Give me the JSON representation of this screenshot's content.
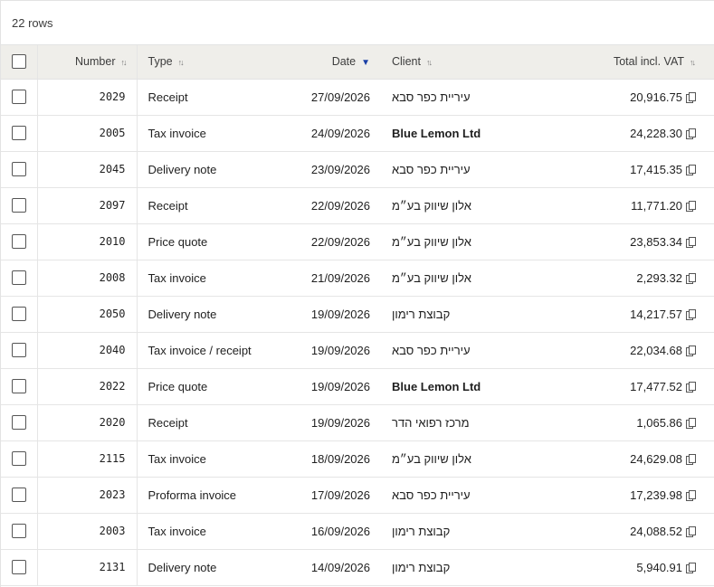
{
  "row_count_label": "22 rows",
  "columns": {
    "number": "Number",
    "type": "Type",
    "date": "Date",
    "client": "Client",
    "total": "Total incl. VAT"
  },
  "sort": {
    "column": "date",
    "direction": "descending"
  },
  "rows": [
    {
      "number": "2029",
      "type": "Receipt",
      "date": "27/09/2026",
      "client": "עיריית כפר סבא",
      "total": "20,916.75"
    },
    {
      "number": "2005",
      "type": "Tax invoice",
      "date": "24/09/2026",
      "client": "Blue Lemon Ltd",
      "total": "24,228.30"
    },
    {
      "number": "2045",
      "type": "Delivery note",
      "date": "23/09/2026",
      "client": "עיריית כפר סבא",
      "total": "17,415.35"
    },
    {
      "number": "2097",
      "type": "Receipt",
      "date": "22/09/2026",
      "client": "אלון שיווק בע״מ",
      "total": "11,771.20"
    },
    {
      "number": "2010",
      "type": "Price quote",
      "date": "22/09/2026",
      "client": "אלון שיווק בע״מ",
      "total": "23,853.34"
    },
    {
      "number": "2008",
      "type": "Tax invoice",
      "date": "21/09/2026",
      "client": "אלון שיווק בע״מ",
      "total": "2,293.32"
    },
    {
      "number": "2050",
      "type": "Delivery note",
      "date": "19/09/2026",
      "client": "קבוצת רימון",
      "total": "14,217.57"
    },
    {
      "number": "2040",
      "type": "Tax invoice / receipt",
      "date": "19/09/2026",
      "client": "עיריית כפר סבא",
      "total": "22,034.68"
    },
    {
      "number": "2022",
      "type": "Price quote",
      "date": "19/09/2026",
      "client": "Blue Lemon Ltd",
      "total": "17,477.52"
    },
    {
      "number": "2020",
      "type": "Receipt",
      "date": "19/09/2026",
      "client": "מרכז רפואי הדר",
      "total": "1,065.86"
    },
    {
      "number": "2115",
      "type": "Tax invoice",
      "date": "18/09/2026",
      "client": "אלון שיווק בע״מ",
      "total": "24,629.08"
    },
    {
      "number": "2023",
      "type": "Proforma invoice",
      "date": "17/09/2026",
      "client": "עיריית כפר סבא",
      "total": "17,239.98"
    },
    {
      "number": "2003",
      "type": "Tax invoice",
      "date": "16/09/2026",
      "client": "קבוצת רימון",
      "total": "24,088.52"
    },
    {
      "number": "2131",
      "type": "Delivery note",
      "date": "14/09/2026",
      "client": "קבוצת רימון",
      "total": "5,940.91"
    }
  ]
}
